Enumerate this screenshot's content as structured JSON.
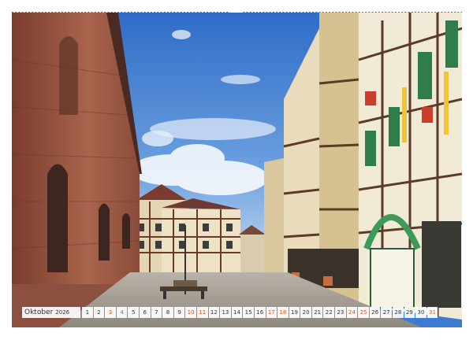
{
  "calendar": {
    "month": "Oktober",
    "year": "2026",
    "days": [
      {
        "n": "1",
        "weekend": false
      },
      {
        "n": "2",
        "weekend": false
      },
      {
        "n": "3",
        "weekend": true
      },
      {
        "n": "4",
        "weekend": true
      },
      {
        "n": "5",
        "weekend": false
      },
      {
        "n": "6",
        "weekend": false
      },
      {
        "n": "7",
        "weekend": false
      },
      {
        "n": "8",
        "weekend": false
      },
      {
        "n": "9",
        "weekend": false
      },
      {
        "n": "10",
        "weekend": true
      },
      {
        "n": "11",
        "weekend": true
      },
      {
        "n": "12",
        "weekend": false
      },
      {
        "n": "13",
        "weekend": false
      },
      {
        "n": "14",
        "weekend": false
      },
      {
        "n": "15",
        "weekend": false
      },
      {
        "n": "16",
        "weekend": false
      },
      {
        "n": "17",
        "weekend": true
      },
      {
        "n": "18",
        "weekend": true
      },
      {
        "n": "19",
        "weekend": false
      },
      {
        "n": "20",
        "weekend": false
      },
      {
        "n": "21",
        "weekend": false
      },
      {
        "n": "22",
        "weekend": false
      },
      {
        "n": "23",
        "weekend": false
      },
      {
        "n": "24",
        "weekend": true
      },
      {
        "n": "25",
        "weekend": true
      },
      {
        "n": "26",
        "weekend": false
      },
      {
        "n": "27",
        "weekend": false
      },
      {
        "n": "28",
        "weekend": false
      },
      {
        "n": "29",
        "weekend": false
      },
      {
        "n": "30",
        "weekend": false
      },
      {
        "n": "31",
        "weekend": true
      }
    ],
    "weekend_color": "#d8552a"
  },
  "photo": {
    "sky_color": "#3d7bd0",
    "church_wall_color": "#9a5a45",
    "timber_color": "#e6d9b8",
    "pavement_color": "#a8a29a"
  }
}
